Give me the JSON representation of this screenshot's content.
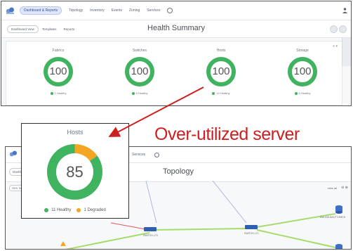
{
  "top": {
    "nav": {
      "items": [
        "Dashboard & Reports",
        "Topology",
        "Inventory",
        "Events",
        "Zoning",
        "Services"
      ]
    },
    "subnav": {
      "dashboard_button": "Dashboard View",
      "templates": "Templates",
      "reports": "Reports"
    },
    "title": "Health Summary",
    "menu_glyph": "≡ ▾",
    "cards": [
      {
        "label": "Fabrics",
        "value": "100",
        "legend": "1 Healthy"
      },
      {
        "label": "Switches",
        "value": "100",
        "legend": "8 Healthy"
      },
      {
        "label": "Hosts",
        "value": "100",
        "legend": "12 Healthy"
      },
      {
        "label": "Storage",
        "value": "100",
        "legend": "6 Healthy"
      }
    ]
  },
  "callout": {
    "label": "Hosts",
    "value": "85",
    "healthy_fraction": 0.85,
    "degraded_fraction": 0.15,
    "legend": [
      {
        "text": "11 Healthy",
        "color": "#3fb35f"
      },
      {
        "text": "1 Degraded",
        "color": "#f2a623"
      }
    ]
  },
  "annotation": "Over-utilized server",
  "bottom": {
    "nav": {
      "services": "Services"
    },
    "subnav": {
      "dashboard_button": "Dashboard",
      "filter": "SDS Te"
    },
    "title": "Topology",
    "view_all": "view all",
    "zoom": "⊖ ⊕",
    "nodes": {
      "switch_a": "SWITCH-170",
      "switch_b": "SWITCH-171",
      "storage_a": "SW-135-Dell-FT-SRCH",
      "storage_b": ""
    }
  },
  "colors": {
    "healthy": "#3fb35f",
    "degraded": "#f2a623",
    "annotation": "#cc1f1f",
    "link_green": "#a7dc6d",
    "link_blue": "#aab7e6",
    "link_red": "#e05a5a",
    "switch": "#2f5fb3",
    "storage": "#3e6fc9"
  }
}
